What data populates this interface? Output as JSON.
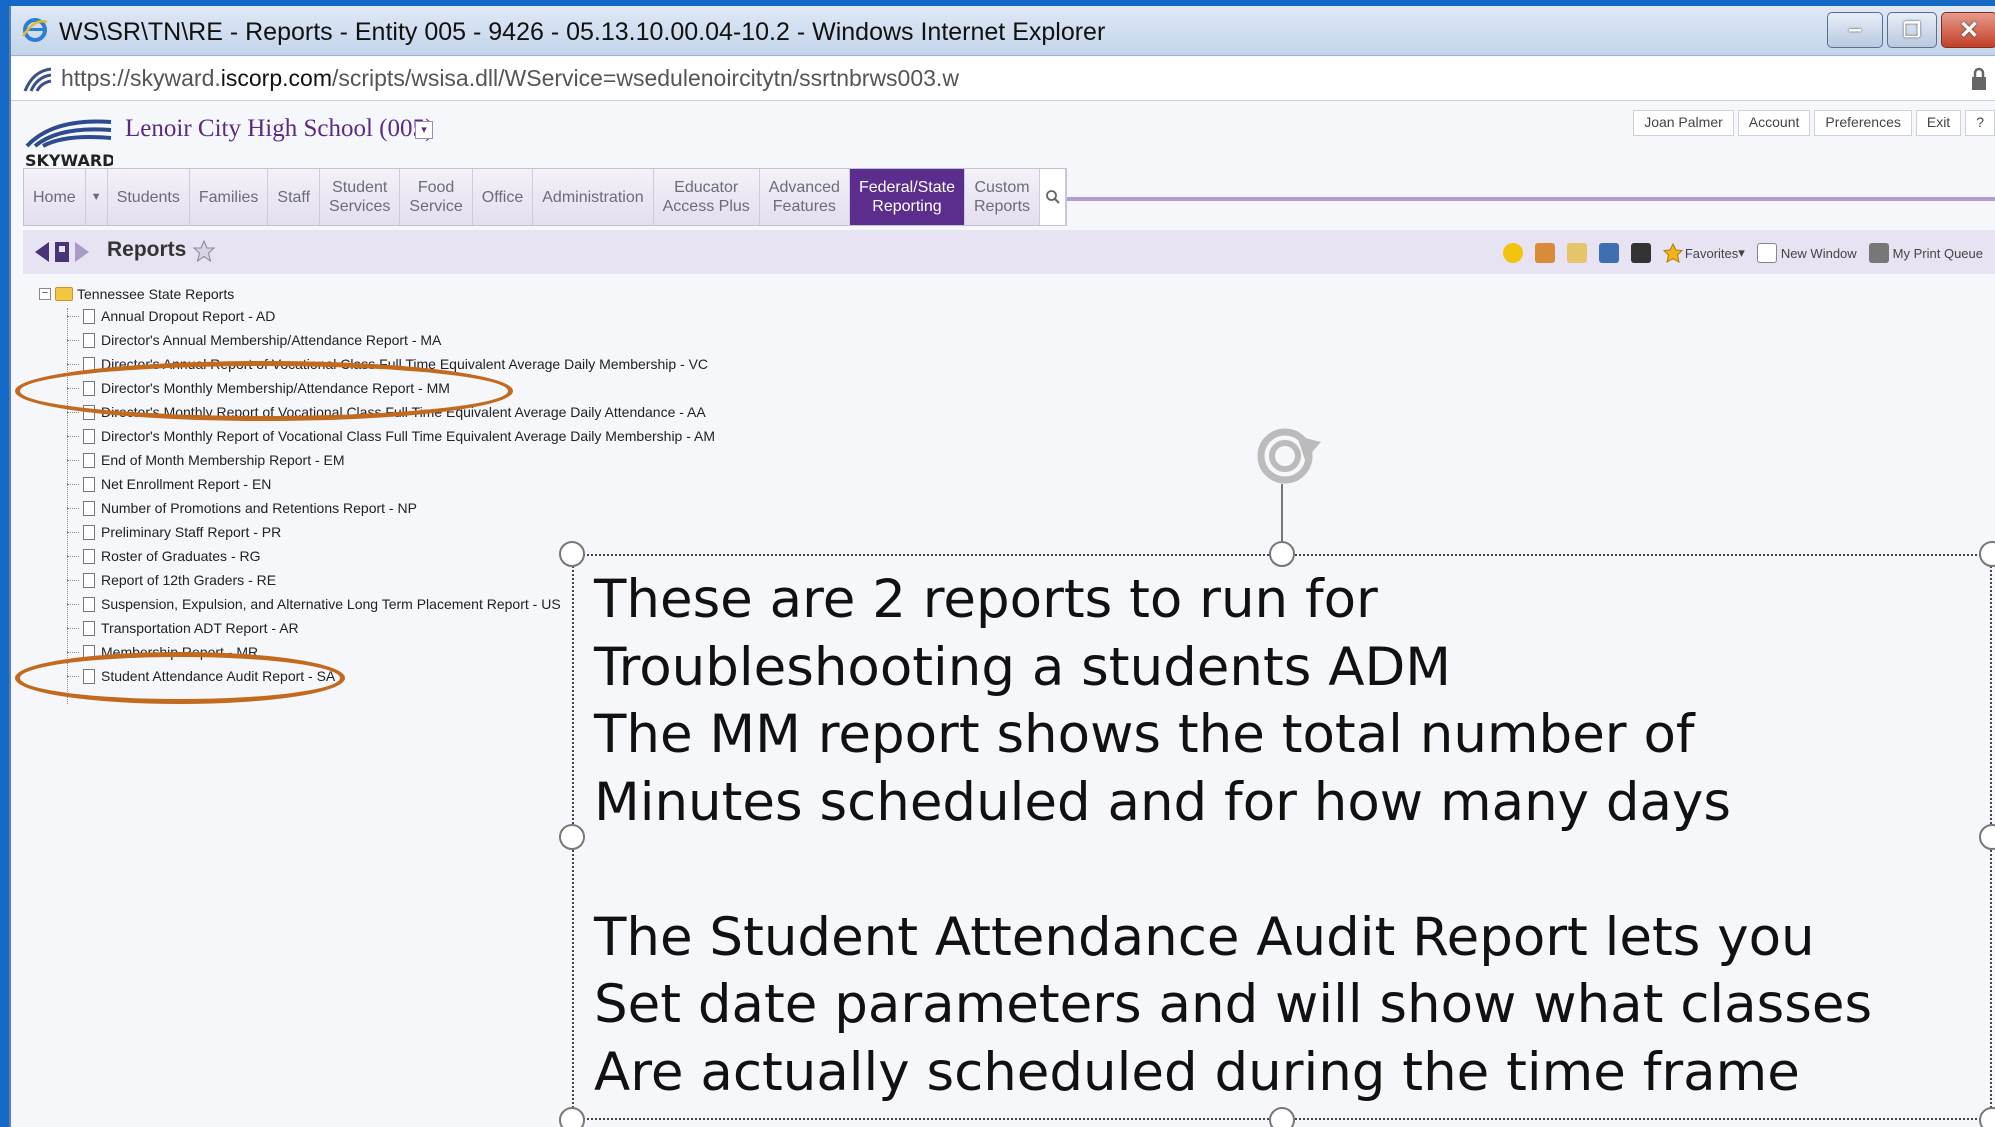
{
  "window": {
    "title": "WS\\SR\\TN\\RE - Reports - Entity 005 - 9426 - 05.13.10.00.04-10.2 - Windows Internet Explorer",
    "controls": {
      "minimize": "–",
      "restore": "❐",
      "close": "✕"
    }
  },
  "address_bar": {
    "prefix": "https://skyward.",
    "domain": "iscorp.com",
    "path": "/scripts/wsisa.dll/WService=wsedulenoircitytn/ssrtnbrws003.w"
  },
  "header": {
    "school": "Lenoir City High School (005)",
    "user_links": [
      "Joan Palmer",
      "Account",
      "Preferences",
      "Exit",
      "?"
    ]
  },
  "nav": {
    "items": [
      {
        "l1": "Home",
        "l2": ""
      },
      {
        "l1": "Students",
        "l2": ""
      },
      {
        "l1": "Families",
        "l2": ""
      },
      {
        "l1": "Staff",
        "l2": ""
      },
      {
        "l1": "Student",
        "l2": "Services"
      },
      {
        "l1": "Food",
        "l2": "Service"
      },
      {
        "l1": "Office",
        "l2": ""
      },
      {
        "l1": "Administration",
        "l2": ""
      },
      {
        "l1": "Educator",
        "l2": "Access Plus"
      },
      {
        "l1": "Advanced",
        "l2": "Features"
      },
      {
        "l1": "Federal/State",
        "l2": "Reporting"
      },
      {
        "l1": "Custom",
        "l2": "Reports"
      }
    ],
    "active": "Federal/State Reporting"
  },
  "page": {
    "title": "Reports",
    "tools": {
      "favorites": "Favorites",
      "new_window": "New Window",
      "print_queue": "My Print Queue"
    }
  },
  "tree": {
    "root": "Tennessee State Reports",
    "items": [
      "Annual Dropout Report - AD",
      "Director's Annual Membership/Attendance Report - MA",
      "Director's Annual Report of Vocational Class Full Time Equivalent Average Daily Membership - VC",
      "Director's Monthly Membership/Attendance Report - MM",
      "Director's Monthly Report of Vocational Class Full Time Equivalent Average Daily Attendance - AA",
      "Director's Monthly Report of Vocational Class Full Time Equivalent Average Daily Membership - AM",
      "End of Month Membership Report - EM",
      "Net Enrollment Report - EN",
      "Number of Promotions and Retentions Report - NP",
      "Preliminary Staff Report - PR",
      "Roster of Graduates - RG",
      "Report of 12th Graders - RE",
      "Suspension, Expulsion, and Alternative Long Term Placement Report - US",
      "Transportation ADT Report - AR",
      "Membership Report - MR",
      "Student Attendance Audit Report - SA"
    ]
  },
  "annotation": {
    "text": "These are 2 reports to run for\nTroubleshooting a students ADM\nThe MM report shows the total number of\nMinutes scheduled and for how many days\n\nThe Student Attendance Audit Report lets you\nSet date parameters and will show what classes\nAre actually scheduled during the time frame"
  },
  "colors": {
    "accent_purple": "#5b2d8c",
    "highlight_oval": "#c26a1e",
    "slide_background": "#1769c7"
  }
}
